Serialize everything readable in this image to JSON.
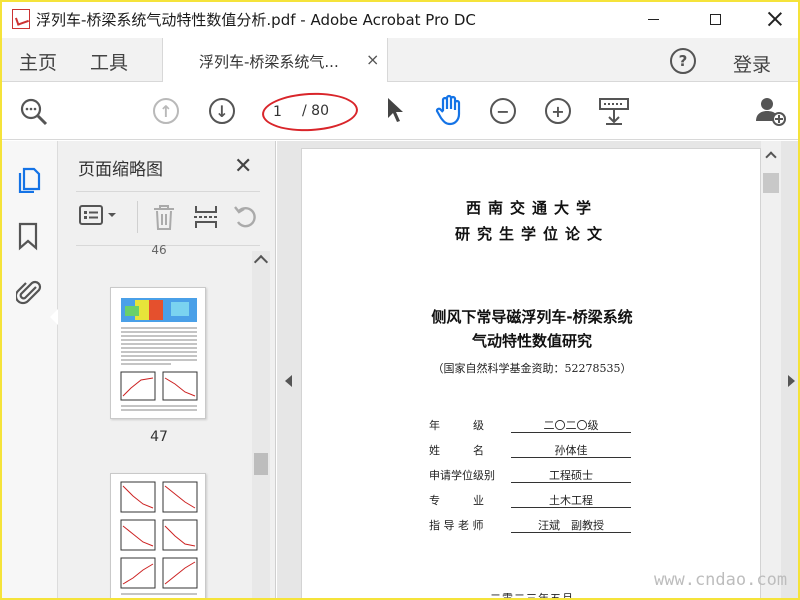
{
  "window": {
    "title": "浮列车-桥梁系统气动特性数值分析.pdf - Adobe Acrobat Pro DC",
    "minimize_label": "minimize",
    "maximize_label": "maximize",
    "close_label": "close"
  },
  "menubar": {
    "home": "主页",
    "tools": "工具",
    "tab_label": "浮列车-桥梁系统气...",
    "tab_close": "×",
    "help": "?",
    "signin": "登录"
  },
  "toolbar": {
    "page_current": "1",
    "page_total": "/ 80",
    "icons": [
      "zoom-search-icon",
      "page-up-icon",
      "page-down-icon",
      "select-arrow-icon",
      "hand-tool-icon",
      "zoom-out-icon",
      "zoom-in-icon",
      "keyboard-icon",
      "add-user-icon"
    ],
    "highlight_color": "#d9252a"
  },
  "leftrail": {
    "icons": [
      "page-thumbnails-icon",
      "bookmark-icon",
      "attachment-icon"
    ],
    "active_color": "#1473e6"
  },
  "thumbnail_panel": {
    "title": "页面缩略图",
    "close": "✕",
    "partial_page_number": "46",
    "pages": [
      {
        "number": "47"
      },
      {
        "number": ""
      }
    ]
  },
  "document": {
    "university_line1": "西南交通大学",
    "university_line2": "研究生学位论文",
    "title_line1": "侧风下常导磁浮列车-桥梁系统",
    "title_line2": "气动特性数值研究",
    "funding": "（国家自然科学基金资助：52278535）",
    "fields": [
      {
        "label": "年　　　级",
        "value": "二〇二〇级"
      },
      {
        "label": "姓　　　名",
        "value": "孙体佳"
      },
      {
        "label": "申请学位级别",
        "value": "工程硕士"
      },
      {
        "label": "专　　　业",
        "value": "土木工程"
      },
      {
        "label": "指 导 老 师",
        "value": "汪斌　副教授"
      }
    ],
    "date": "二零二三年五月"
  },
  "watermark": "www.cndao.com"
}
